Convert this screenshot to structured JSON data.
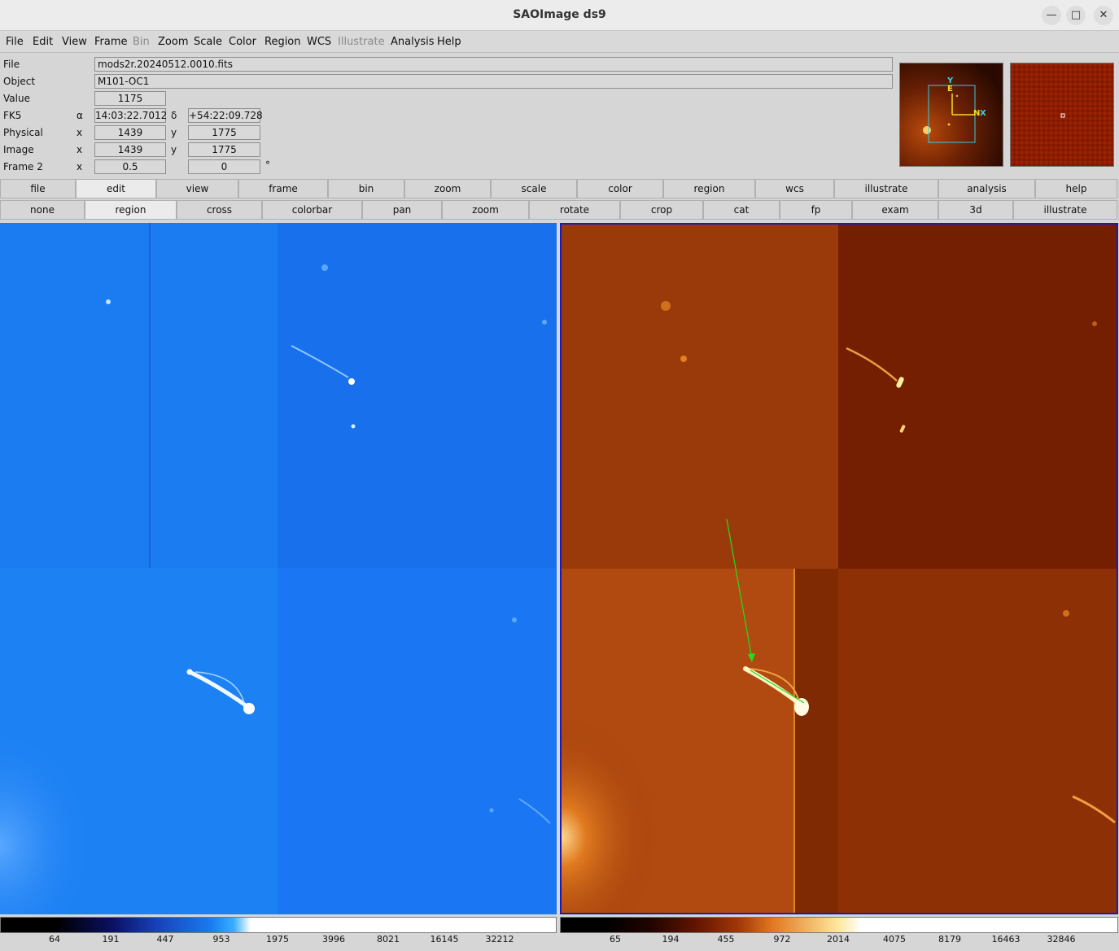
{
  "window": {
    "title": "SAOImage ds9"
  },
  "menu": [
    "File",
    "Edit",
    "View",
    "Frame",
    "Bin",
    "Zoom",
    "Scale",
    "Color",
    "Region",
    "WCS",
    "Illustrate",
    "Analysis",
    "Help"
  ],
  "menu_disabled": [
    "Bin",
    "Illustrate"
  ],
  "info": {
    "file_label": "File",
    "file_value": "mods2r.20240512.0010.fits",
    "object_label": "Object",
    "object_value": "M101-OC1",
    "value_label": "Value",
    "value_value": "1175",
    "fk5_label": "FK5",
    "alpha_symbol": "α",
    "alpha_value": "14:03:22.7012",
    "delta_symbol": "δ",
    "delta_value": "+54:22:09.728",
    "physical_label": "Physical",
    "physical_x_label": "x",
    "physical_x": "1439",
    "physical_y_label": "y",
    "physical_y": "1775",
    "image_label": "Image",
    "image_x_label": "x",
    "image_x": "1439",
    "image_y_label": "y",
    "image_y": "1775",
    "frame2_label": "Frame 2",
    "frame2_x_label": "x",
    "frame2_x": "0.5",
    "frame2_angle": "0",
    "degree_symbol": "°"
  },
  "panner": {
    "compass_n": "N",
    "compass_e": "E",
    "axis_x": "X",
    "axis_y": "Y"
  },
  "buttonbar1": [
    "file",
    "edit",
    "view",
    "frame",
    "bin",
    "zoom",
    "scale",
    "color",
    "region",
    "wcs",
    "illustrate",
    "analysis",
    "help"
  ],
  "buttonbar1_active": "edit",
  "buttonbar2": [
    "none",
    "region",
    "cross",
    "colorbar",
    "pan",
    "zoom",
    "rotate",
    "crop",
    "cat",
    "fp",
    "exam",
    "3d",
    "illustrate"
  ],
  "buttonbar2_active": "region",
  "colorbar1": {
    "ticks": [
      "64",
      "191",
      "447",
      "953",
      "1975",
      "3996",
      "8021",
      "16145",
      "32212"
    ]
  },
  "colorbar2": {
    "ticks": [
      "65",
      "194",
      "455",
      "972",
      "2014",
      "4075",
      "8179",
      "16463",
      "32846"
    ]
  },
  "colors": {
    "frame1_base": "#1a78f0",
    "frame2_base": "#9a3608",
    "frame_highlight": "#1a1ab8",
    "region_arrow": "#22dd22"
  }
}
